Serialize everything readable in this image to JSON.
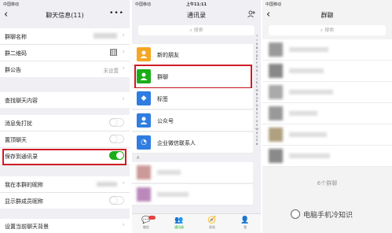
{
  "left_panel": {
    "status": {
      "carrier": "中国移动",
      "right": "",
      "time": ""
    },
    "nav_title": "聊天信息(11)",
    "back_glyph": "‹",
    "more_glyph": "•••",
    "rows": {
      "group_name": {
        "label": "群聊名称"
      },
      "group_qr": {
        "label": "群二维码"
      },
      "announcement": {
        "label": "群公告",
        "value": "未设置"
      },
      "find_chat": {
        "label": "查找聊天内容"
      },
      "mute": {
        "label": "消息免打扰",
        "on": false
      },
      "pin": {
        "label": "置顶聊天",
        "on": false
      },
      "save_contacts": {
        "label": "保存到通讯录",
        "on": true
      },
      "my_alias": {
        "label": "我在本群的昵称"
      },
      "show_alias": {
        "label": "显示群成员昵称",
        "on": false
      },
      "background": {
        "label": "设置当前聊天背景"
      }
    }
  },
  "middle_panel": {
    "status": {
      "carrier": "中国移动",
      "time": "上午11:11"
    },
    "nav_title": "通讯录",
    "search_placeholder": "搜索",
    "items": {
      "new_friends": {
        "label": "新的朋友",
        "color": "#f5a623"
      },
      "group_chats": {
        "label": "群聊",
        "color": "#1aad19"
      },
      "tags": {
        "label": "标签",
        "color": "#2f7de1"
      },
      "official": {
        "label": "公众号",
        "color": "#2f7de1"
      },
      "work_contacts": {
        "label": "企业微信联系人",
        "color": "#2f7de1"
      }
    },
    "section_letter": "A",
    "alphabet": [
      "↑",
      "☆",
      "A",
      "B",
      "C",
      "D",
      "E",
      "F",
      "G",
      "H",
      "I",
      "J",
      "K",
      "L",
      "M",
      "N",
      "O",
      "P",
      "Q",
      "R",
      "S",
      "T",
      "U",
      "V",
      "W",
      "X",
      "Y",
      "Z",
      "#"
    ],
    "tabs": {
      "chats": {
        "label": "微信",
        "icon": "chat-icon"
      },
      "contacts": {
        "label": "通讯录",
        "icon": "contacts-icon"
      },
      "discover": {
        "label": "发现",
        "icon": "compass-icon"
      },
      "me": {
        "label": "我",
        "icon": "person-icon"
      }
    }
  },
  "right_panel": {
    "status": {
      "carrier": "中国移动",
      "time": ""
    },
    "nav_title": "群聊",
    "search_placeholder": "搜索",
    "count_text": "6个群聊"
  },
  "watermark": "电脑手机冷知识",
  "colors": {
    "highlight": "#d01b24",
    "wechat_green": "#1aad19"
  }
}
